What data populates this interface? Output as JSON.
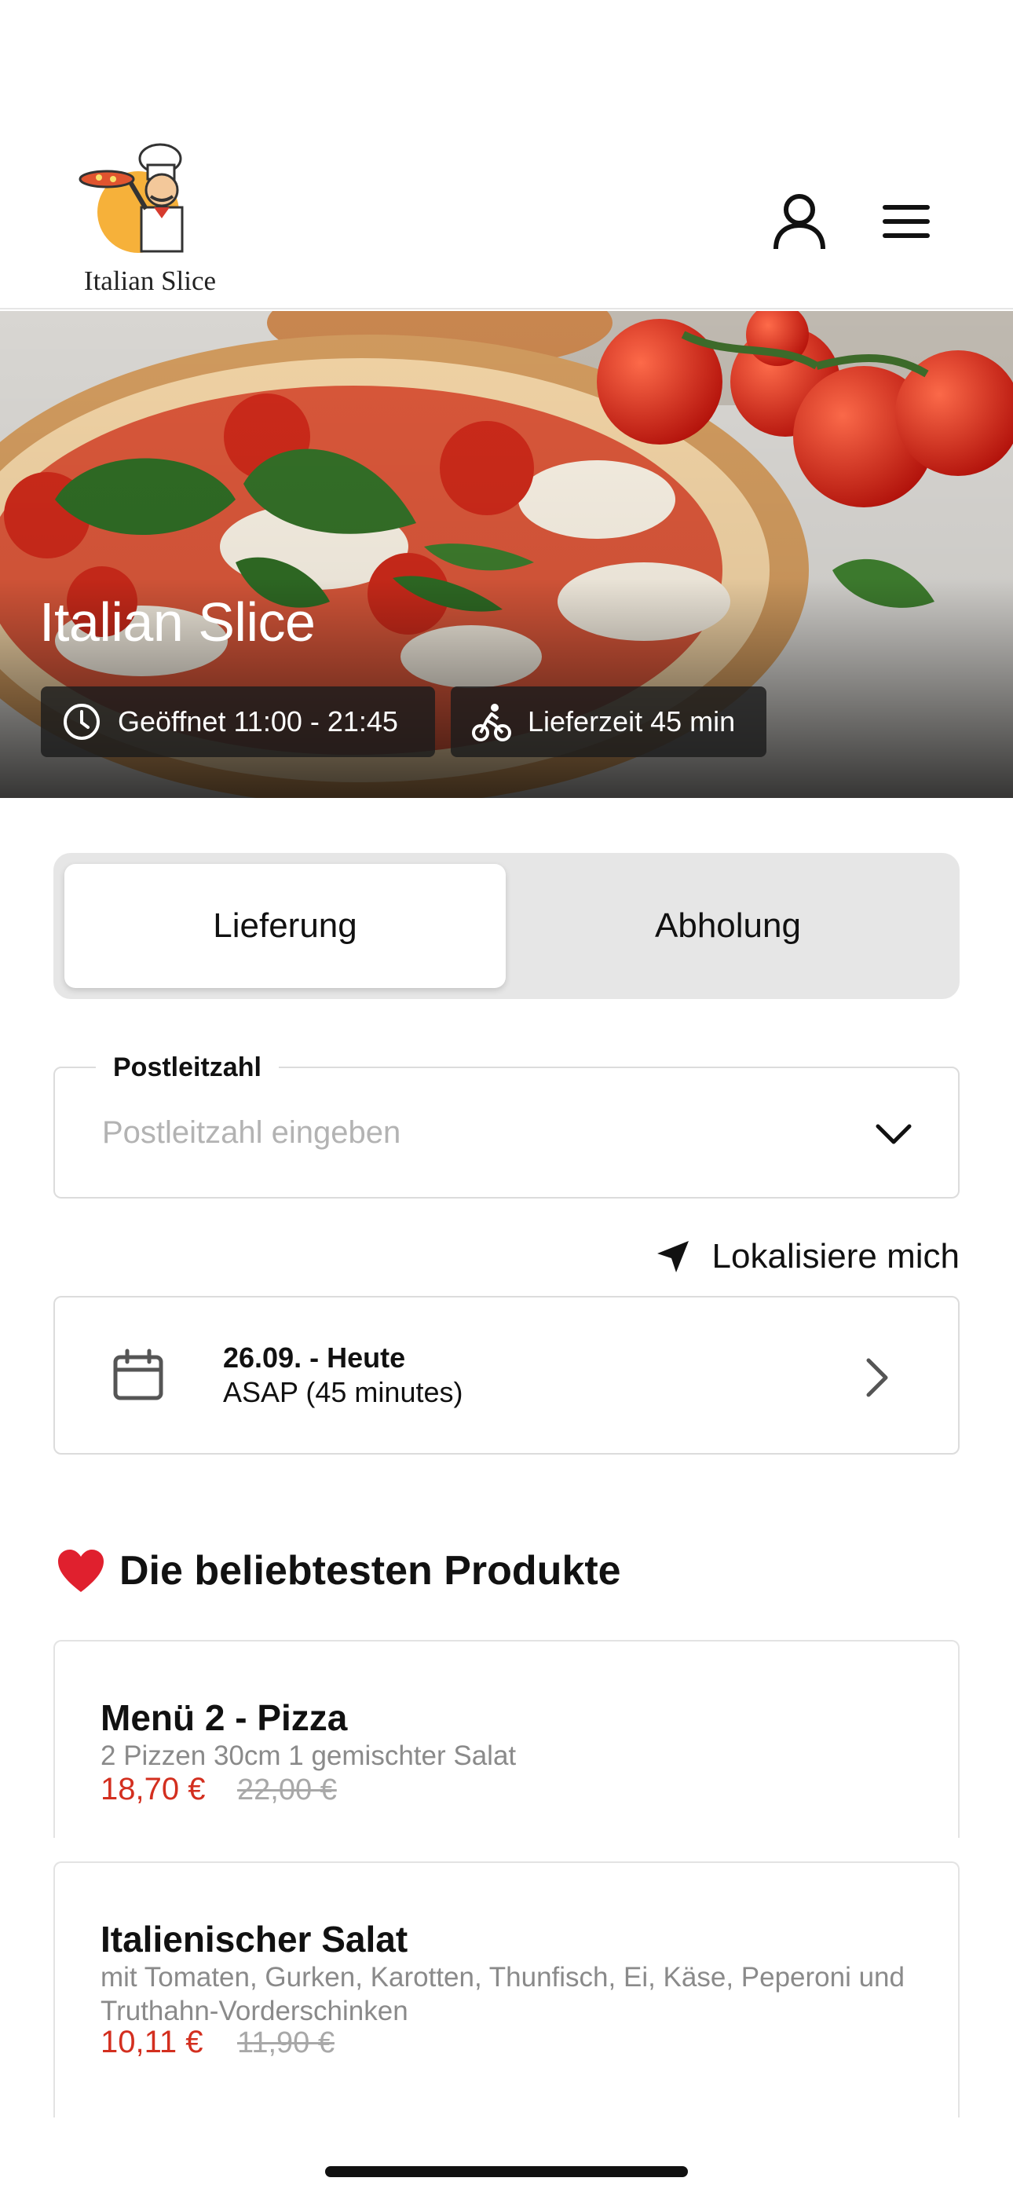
{
  "brand": {
    "logo_text": "Italian Slice"
  },
  "header": {
    "user_icon": "user-icon",
    "menu_icon": "hamburger-menu-icon"
  },
  "hero": {
    "title": "Italian Slice",
    "opening": "Geöffnet 11:00 - 21:45",
    "delivery_time": "Lieferzeit 45 min"
  },
  "order_mode": {
    "options": [
      "Lieferung",
      "Abholung"
    ],
    "selected": "Lieferung"
  },
  "postal": {
    "label": "Postleitzahl",
    "placeholder": "Postleitzahl eingeben",
    "value": ""
  },
  "locate": {
    "label": "Lokalisiere mich"
  },
  "date": {
    "title": "26.09. - Heute",
    "subtitle": "ASAP (45 minutes)"
  },
  "popular": {
    "title": "Die beliebtesten Produkte",
    "products": [
      {
        "name": "Menü 2 - Pizza",
        "description": "2 Pizzen 30cm 1 gemischter Salat",
        "price": "18,70 €",
        "old_price": "22,00 €"
      },
      {
        "name": "Italienischer Salat",
        "description": "mit Tomaten, Gurken, Karotten, Thunfisch, Ei, Käse, Peperoni und Truthahn-Vorderschinken",
        "price": "10,11 €",
        "old_price": "11,90 €"
      }
    ]
  },
  "colors": {
    "price": "#d32f1f",
    "segment_bg": "#e6e6e6",
    "chip_bg": "#1c1c1c"
  }
}
